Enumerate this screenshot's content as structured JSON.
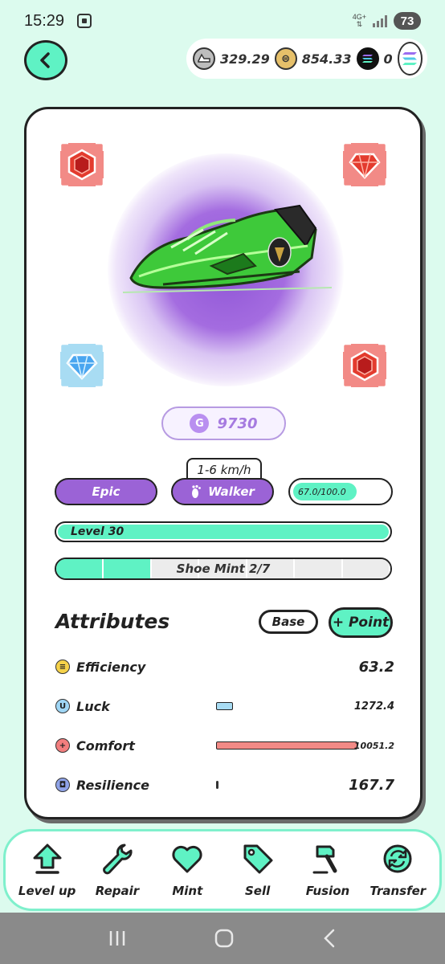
{
  "status_bar": {
    "time": "15:29",
    "network": "4G+",
    "battery": "73"
  },
  "header": {
    "balances": [
      {
        "icon": "gst-coin-icon",
        "value": "329.29"
      },
      {
        "icon": "gmt-coin-icon",
        "value": "854.33"
      },
      {
        "icon": "sol-coin-icon",
        "value": "0"
      }
    ]
  },
  "sneaker": {
    "gem_slots": [
      "ruby-gem-icon",
      "ruby-gem-icon",
      "diamond-gem-icon",
      "ruby-gem-icon"
    ],
    "price": "9730",
    "price_coin_letter": "G",
    "speed_range": "1-6 km/h",
    "rarity": "Epic",
    "type": "Walker",
    "durability_text": "67.0/100.0",
    "durability_fraction": 0.67,
    "level_text": "Level 30",
    "level_fill_fraction": 1.0,
    "mint_text": "Shoe Mint 2/7",
    "mint_used": 2,
    "mint_total": 7
  },
  "attributes": {
    "title": "Attributes",
    "base_label": "Base",
    "point_label": "+ Point",
    "rows": [
      {
        "name": "Efficiency",
        "value": "63.2",
        "icon_glyph": "≡",
        "icon_color": "#f5d24a",
        "bar_fraction": 0.0,
        "bar_color": "#f5d24a"
      },
      {
        "name": "Luck",
        "value": "1272.4",
        "icon_glyph": "U",
        "icon_color": "#9fd6f5",
        "bar_fraction": 0.12,
        "bar_color": "#a8dcf3"
      },
      {
        "name": "Comfort",
        "value": "10051.2",
        "icon_glyph": "+",
        "icon_color": "#f27e7e",
        "bar_fraction": 1.0,
        "bar_color": "#f28a86"
      },
      {
        "name": "Resilience",
        "value": "167.7",
        "icon_glyph": "◘",
        "icon_color": "#8fa3e8",
        "bar_fraction": 0.01,
        "bar_color": "#333333"
      }
    ]
  },
  "bottom_nav": [
    {
      "label": "Level up",
      "icon": "level-up-icon"
    },
    {
      "label": "Repair",
      "icon": "wrench-icon"
    },
    {
      "label": "Mint",
      "icon": "heart-icon"
    },
    {
      "label": "Sell",
      "icon": "tag-icon"
    },
    {
      "label": "Fusion",
      "icon": "hammer-icon"
    },
    {
      "label": "Transfer",
      "icon": "transfer-icon"
    }
  ],
  "colors": {
    "background": "#dcfbee",
    "accent_mint": "#5ff2c4",
    "accent_purple": "#9b63d6",
    "card_border": "#222222"
  }
}
